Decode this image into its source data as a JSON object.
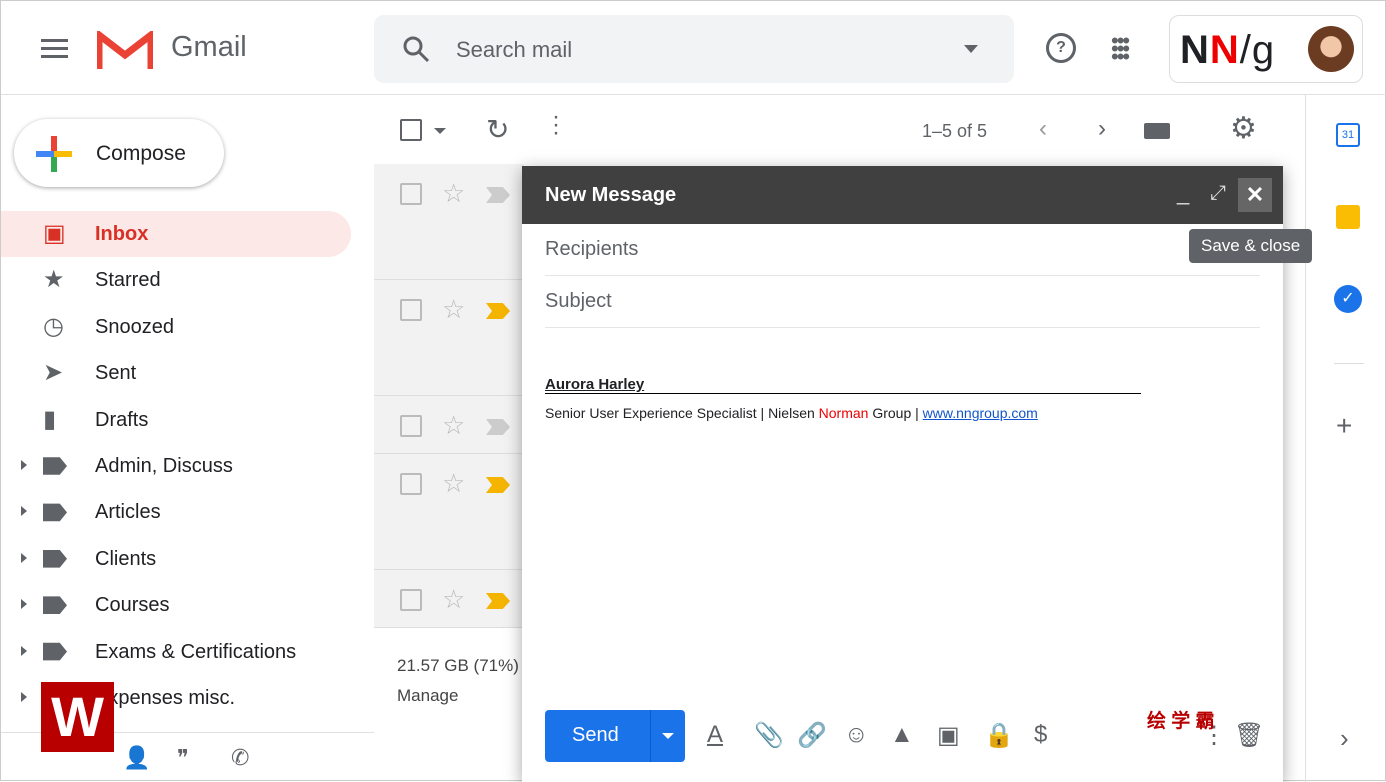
{
  "header": {
    "app_name": "Gmail",
    "search_placeholder": "Search mail",
    "brand": "NN/g"
  },
  "sidebar": {
    "compose": "Compose",
    "items": [
      {
        "label": "Inbox",
        "icon": "inbox-icon"
      },
      {
        "label": "Starred",
        "icon": "star-icon"
      },
      {
        "label": "Snoozed",
        "icon": "clock-icon"
      },
      {
        "label": "Sent",
        "icon": "send-icon"
      },
      {
        "label": "Drafts",
        "icon": "draft-icon"
      },
      {
        "label": "Admin, Discuss",
        "icon": "label-icon"
      },
      {
        "label": "Articles",
        "icon": "label-icon"
      },
      {
        "label": "Clients",
        "icon": "label-icon"
      },
      {
        "label": "Courses",
        "icon": "label-icon"
      },
      {
        "label": "Exams & Certifications",
        "icon": "label-icon"
      },
      {
        "label": "Expenses misc.",
        "icon": "label-icon"
      }
    ]
  },
  "toolbar": {
    "pagination": "1–5 of 5"
  },
  "storage": {
    "usage": "21.57 GB (71%)",
    "manage": "Manage"
  },
  "compose_window": {
    "title": "New Message",
    "recipients_placeholder": "Recipients",
    "subject_placeholder": "Subject",
    "signature_name": "Aurora Harley",
    "signature_title": "Senior User Experience Specialist | Nielsen ",
    "signature_norman": "Norman",
    "signature_group": " Group | ",
    "signature_link": "www.nngroup.com",
    "send": "Send",
    "tooltip": "Save & close"
  },
  "watermark": {
    "logo": "W",
    "text": "绘 学 霸"
  },
  "colors": {
    "accent": "#1a73e8",
    "inbox_red": "#d93025"
  }
}
